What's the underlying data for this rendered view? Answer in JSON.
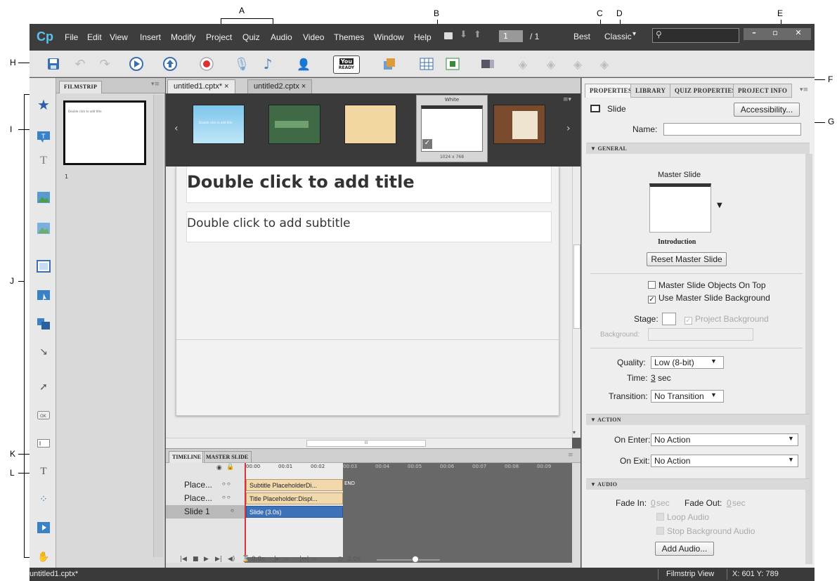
{
  "callouts": {
    "A": "A",
    "B": "B",
    "C": "C",
    "D": "D",
    "E": "E",
    "F": "F",
    "G": "G",
    "H": "H",
    "I": "I",
    "J": "J",
    "K": "K",
    "L": "L"
  },
  "app": {
    "logo": "Cp"
  },
  "menu": [
    "File",
    "Edit",
    "View",
    "Insert",
    "Modify",
    "Project",
    "Quiz",
    "Audio",
    "Video",
    "Themes",
    "Window",
    "Help"
  ],
  "nav": {
    "page": "1",
    "total": "/ 1",
    "quality": "Best",
    "workspace": "Classic"
  },
  "toolbar_icons": [
    "save-icon",
    "undo-icon",
    "redo-icon",
    "preview-icon",
    "publish-icon",
    "record-icon",
    "microphone-icon",
    "audio-note-icon",
    "user-icon",
    "youtube-icon",
    "share-icon",
    "grid-icon",
    "fit-icon",
    "toggle-icon",
    "quiz-icon-1",
    "quiz-icon-2",
    "quiz-icon-3",
    "quiz-icon-4"
  ],
  "youtube": {
    "top": "You",
    "sub": "READY"
  },
  "doc_tabs": [
    {
      "label": "untitled1.cptx*",
      "close": "×"
    },
    {
      "label": "untitled2.cptx",
      "close": "×"
    }
  ],
  "filmstrip": {
    "tab": "FILMSTRIP",
    "slide_number": "1",
    "thumb_text": "Double click to add title"
  },
  "themes": {
    "selected_label": "White",
    "selected_size": "1024 x 768",
    "thumb_text": "Double click to add title"
  },
  "slide": {
    "title": "Double click to add title",
    "subtitle": "Double click to add subtitle"
  },
  "hscroll_mark": "III",
  "timeline": {
    "tabs": [
      "TIMELINE",
      "MASTER SLIDE"
    ],
    "ticks": [
      "00:00",
      "00:01",
      "00:02",
      "00:03",
      "00:04",
      "00:05",
      "00:06",
      "00:07",
      "00:08",
      "00:09"
    ],
    "rows": [
      {
        "name": "Place...",
        "bar": "Subtitle PlaceholderDi..."
      },
      {
        "name": "Place...",
        "bar": "Title Placeholder:Displ..."
      },
      {
        "name": "Slide 1",
        "bar": "Slide (3.0s)"
      }
    ],
    "end_label": "END",
    "time_now": "0.0s",
    "time_a": "--",
    "time_b": "--",
    "duration": "3.0s"
  },
  "properties": {
    "tabs": [
      "PROPERTIES",
      "LIBRARY",
      "QUIZ PROPERTIES",
      "PROJECT INFO"
    ],
    "object_type": "Slide",
    "accessibility": "Accessibility...",
    "name_label": "Name:",
    "name_value": "",
    "general": "GENERAL",
    "master_slide_label": "Master Slide",
    "master_name": "Introduction",
    "reset_master": "Reset Master Slide",
    "master_on_top": "Master Slide Objects On Top",
    "use_master_bg": "Use Master Slide Background",
    "stage_label": "Stage:",
    "project_background": "Project Background",
    "background_label": "Background:",
    "quality_label": "Quality:",
    "quality_value": "Low (8-bit)",
    "time_label": "Time:",
    "time_value": "3",
    "time_unit": "sec",
    "transition_label": "Transition:",
    "transition_value": "No Transition",
    "action": "ACTION",
    "on_enter_label": "On Enter:",
    "on_enter_value": "No Action",
    "on_exit_label": "On Exit:",
    "on_exit_value": "No Action",
    "audio": "AUDIO",
    "fade_in_label": "Fade In:",
    "fade_in_value": "0",
    "fade_out_label": "Fade Out:",
    "fade_out_value": "0",
    "sec": "sec",
    "loop_audio": "Loop Audio",
    "stop_bg_audio": "Stop Background Audio",
    "add_audio": "Add Audio..."
  },
  "status": {
    "file": "untitled1.cptx*",
    "view": "Filmstrip View",
    "coords": "X: 601 Y: 789"
  }
}
